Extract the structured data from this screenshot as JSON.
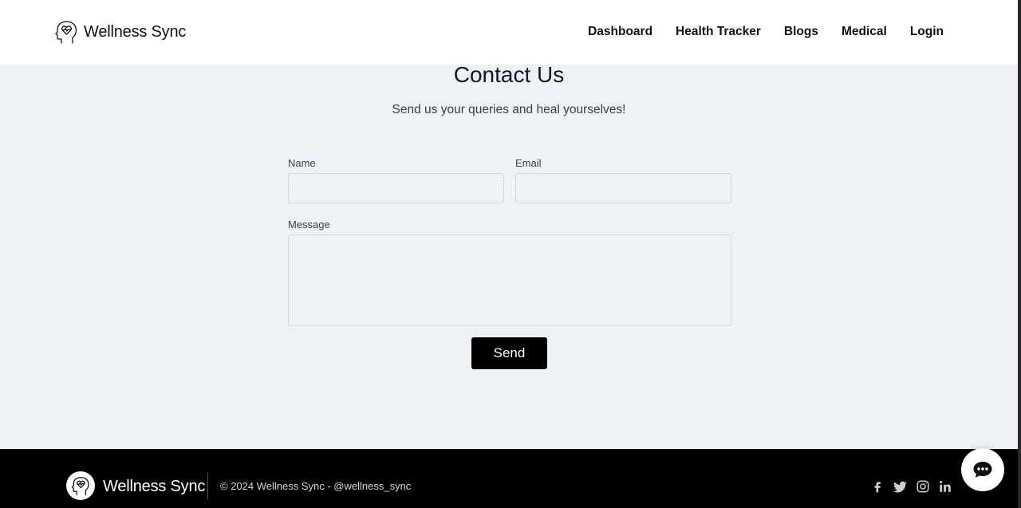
{
  "brand": {
    "name": "Wellness Sync",
    "logo_icon": "head-heart-icon"
  },
  "nav": {
    "items": [
      {
        "label": "Dashboard"
      },
      {
        "label": "Health Tracker"
      },
      {
        "label": "Blogs"
      },
      {
        "label": "Medical"
      },
      {
        "label": "Login"
      }
    ]
  },
  "contact": {
    "title": "Contact Us",
    "subtitle": "Send us your queries and heal yourselves!",
    "name_label": "Name",
    "email_label": "Email",
    "message_label": "Message",
    "name_value": "",
    "email_value": "",
    "message_value": "",
    "send_label": "Send"
  },
  "footer": {
    "brand": "Wellness Sync",
    "copyright": "© 2024 Wellness Sync - @wellness_sync",
    "social_icons": [
      "facebook-icon",
      "twitter-icon",
      "instagram-icon",
      "linkedin-icon"
    ]
  },
  "chat": {
    "icon": "chat-bubble-icon"
  },
  "colors": {
    "nav_bg": "#ffffff",
    "page_bg": "#f0f1f4",
    "footer_bg": "#000000",
    "button_bg": "#000000",
    "button_text": "#ffffff"
  }
}
